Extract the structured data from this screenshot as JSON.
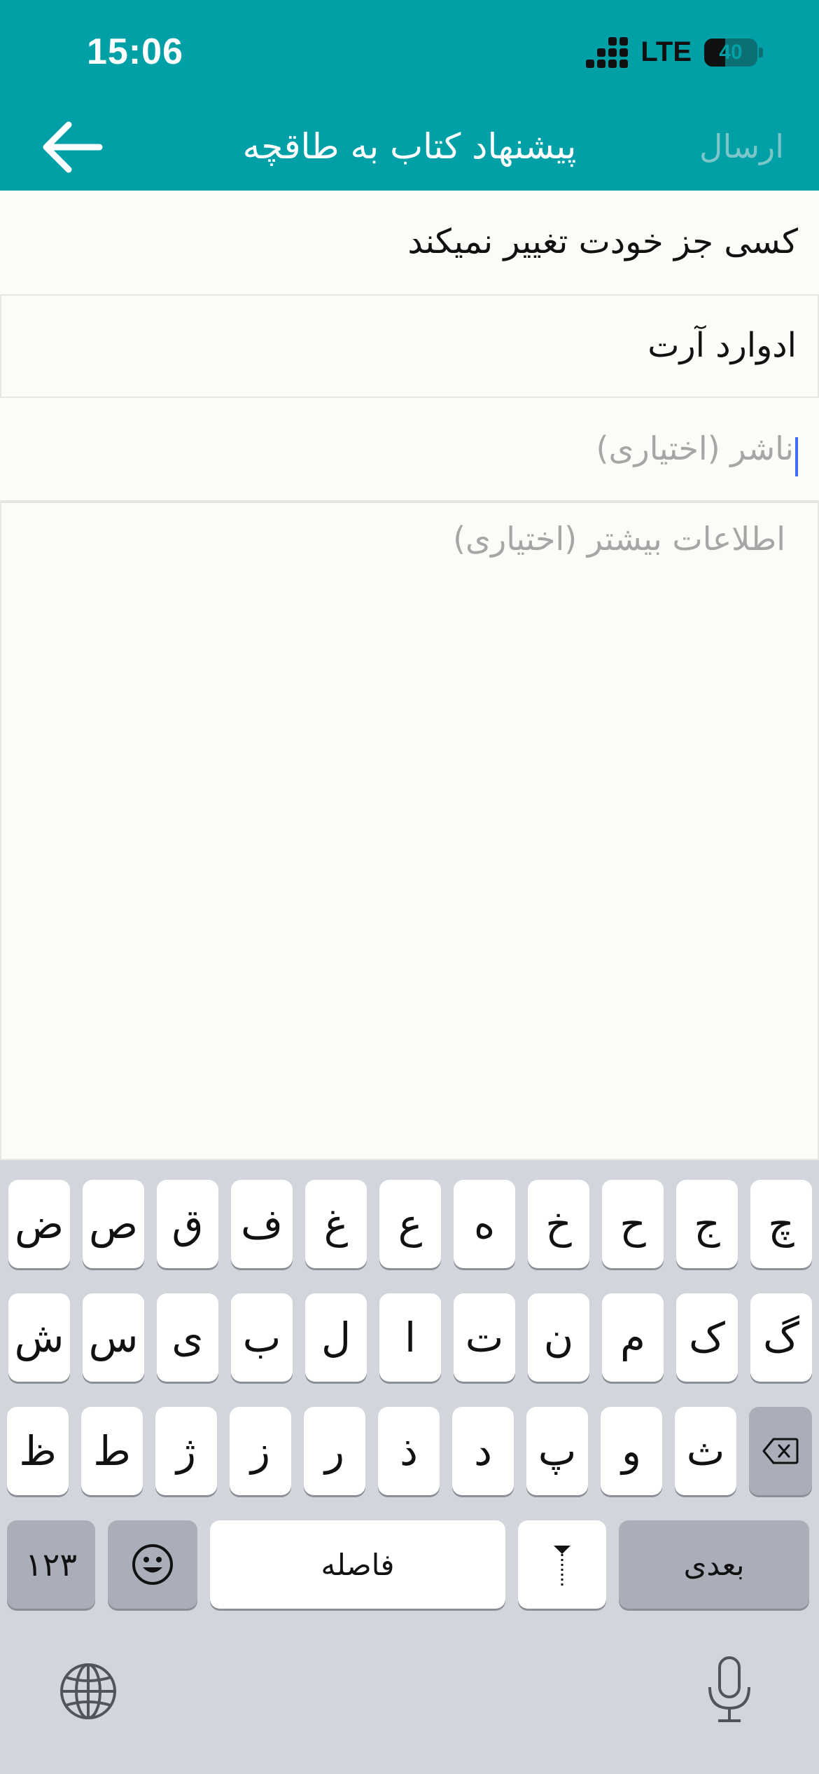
{
  "status_bar": {
    "time": "15:06",
    "network": "LTE",
    "battery": "40",
    "battery_level": 0.4
  },
  "header": {
    "title": "پیشنهاد کتاب به طاقچه",
    "send_label": "ارسال",
    "back_icon": "arrow-left-icon",
    "background": "#00a0a6"
  },
  "form": {
    "title_value": "کسی جز خودت تغییر نمیکند",
    "author_value": "ادوارد آرت",
    "publisher_placeholder": "ناشر (اختیاری)",
    "info_placeholder": "اطلاعات بیشتر (اختیاری)"
  },
  "keyboard": {
    "row1": [
      "چ",
      "ج",
      "ح",
      "خ",
      "ه",
      "ع",
      "غ",
      "ف",
      "ق",
      "ص",
      "ض"
    ],
    "row2": [
      "گ",
      "ک",
      "م",
      "ن",
      "ت",
      "ا",
      "ل",
      "ب",
      "ی",
      "س",
      "ش"
    ],
    "row3": [
      "ث",
      "و",
      "پ",
      "د",
      "ذ",
      "ر",
      "ز",
      "ژ",
      "ط",
      "ظ"
    ],
    "numbers_label": "۱۲۳",
    "space_label": "فاصله",
    "next_label": "بعدی",
    "emoji_icon": "emoji-icon",
    "zwnj_icon": "zwnj-icon",
    "delete_icon": "delete-icon",
    "globe_icon": "globe-icon",
    "mic_icon": "microphone-icon"
  }
}
